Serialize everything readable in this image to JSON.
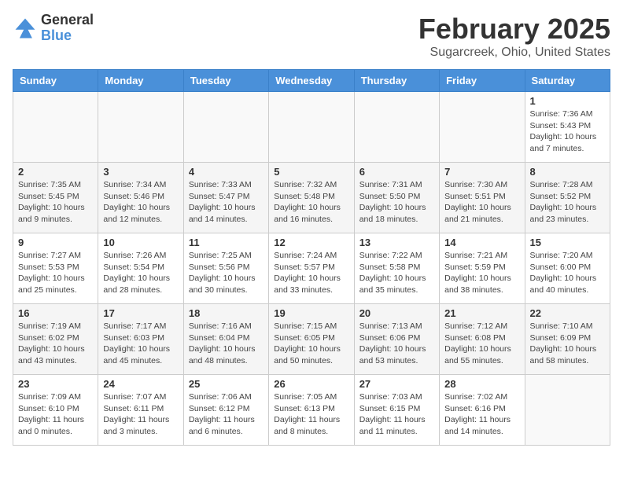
{
  "header": {
    "logo_general": "General",
    "logo_blue": "Blue",
    "month_year": "February 2025",
    "location": "Sugarcreek, Ohio, United States"
  },
  "days_of_week": [
    "Sunday",
    "Monday",
    "Tuesday",
    "Wednesday",
    "Thursday",
    "Friday",
    "Saturday"
  ],
  "weeks": [
    [
      {
        "num": "",
        "info": ""
      },
      {
        "num": "",
        "info": ""
      },
      {
        "num": "",
        "info": ""
      },
      {
        "num": "",
        "info": ""
      },
      {
        "num": "",
        "info": ""
      },
      {
        "num": "",
        "info": ""
      },
      {
        "num": "1",
        "info": "Sunrise: 7:36 AM\nSunset: 5:43 PM\nDaylight: 10 hours\nand 7 minutes."
      }
    ],
    [
      {
        "num": "2",
        "info": "Sunrise: 7:35 AM\nSunset: 5:45 PM\nDaylight: 10 hours\nand 9 minutes."
      },
      {
        "num": "3",
        "info": "Sunrise: 7:34 AM\nSunset: 5:46 PM\nDaylight: 10 hours\nand 12 minutes."
      },
      {
        "num": "4",
        "info": "Sunrise: 7:33 AM\nSunset: 5:47 PM\nDaylight: 10 hours\nand 14 minutes."
      },
      {
        "num": "5",
        "info": "Sunrise: 7:32 AM\nSunset: 5:48 PM\nDaylight: 10 hours\nand 16 minutes."
      },
      {
        "num": "6",
        "info": "Sunrise: 7:31 AM\nSunset: 5:50 PM\nDaylight: 10 hours\nand 18 minutes."
      },
      {
        "num": "7",
        "info": "Sunrise: 7:30 AM\nSunset: 5:51 PM\nDaylight: 10 hours\nand 21 minutes."
      },
      {
        "num": "8",
        "info": "Sunrise: 7:28 AM\nSunset: 5:52 PM\nDaylight: 10 hours\nand 23 minutes."
      }
    ],
    [
      {
        "num": "9",
        "info": "Sunrise: 7:27 AM\nSunset: 5:53 PM\nDaylight: 10 hours\nand 25 minutes."
      },
      {
        "num": "10",
        "info": "Sunrise: 7:26 AM\nSunset: 5:54 PM\nDaylight: 10 hours\nand 28 minutes."
      },
      {
        "num": "11",
        "info": "Sunrise: 7:25 AM\nSunset: 5:56 PM\nDaylight: 10 hours\nand 30 minutes."
      },
      {
        "num": "12",
        "info": "Sunrise: 7:24 AM\nSunset: 5:57 PM\nDaylight: 10 hours\nand 33 minutes."
      },
      {
        "num": "13",
        "info": "Sunrise: 7:22 AM\nSunset: 5:58 PM\nDaylight: 10 hours\nand 35 minutes."
      },
      {
        "num": "14",
        "info": "Sunrise: 7:21 AM\nSunset: 5:59 PM\nDaylight: 10 hours\nand 38 minutes."
      },
      {
        "num": "15",
        "info": "Sunrise: 7:20 AM\nSunset: 6:00 PM\nDaylight: 10 hours\nand 40 minutes."
      }
    ],
    [
      {
        "num": "16",
        "info": "Sunrise: 7:19 AM\nSunset: 6:02 PM\nDaylight: 10 hours\nand 43 minutes."
      },
      {
        "num": "17",
        "info": "Sunrise: 7:17 AM\nSunset: 6:03 PM\nDaylight: 10 hours\nand 45 minutes."
      },
      {
        "num": "18",
        "info": "Sunrise: 7:16 AM\nSunset: 6:04 PM\nDaylight: 10 hours\nand 48 minutes."
      },
      {
        "num": "19",
        "info": "Sunrise: 7:15 AM\nSunset: 6:05 PM\nDaylight: 10 hours\nand 50 minutes."
      },
      {
        "num": "20",
        "info": "Sunrise: 7:13 AM\nSunset: 6:06 PM\nDaylight: 10 hours\nand 53 minutes."
      },
      {
        "num": "21",
        "info": "Sunrise: 7:12 AM\nSunset: 6:08 PM\nDaylight: 10 hours\nand 55 minutes."
      },
      {
        "num": "22",
        "info": "Sunrise: 7:10 AM\nSunset: 6:09 PM\nDaylight: 10 hours\nand 58 minutes."
      }
    ],
    [
      {
        "num": "23",
        "info": "Sunrise: 7:09 AM\nSunset: 6:10 PM\nDaylight: 11 hours\nand 0 minutes."
      },
      {
        "num": "24",
        "info": "Sunrise: 7:07 AM\nSunset: 6:11 PM\nDaylight: 11 hours\nand 3 minutes."
      },
      {
        "num": "25",
        "info": "Sunrise: 7:06 AM\nSunset: 6:12 PM\nDaylight: 11 hours\nand 6 minutes."
      },
      {
        "num": "26",
        "info": "Sunrise: 7:05 AM\nSunset: 6:13 PM\nDaylight: 11 hours\nand 8 minutes."
      },
      {
        "num": "27",
        "info": "Sunrise: 7:03 AM\nSunset: 6:15 PM\nDaylight: 11 hours\nand 11 minutes."
      },
      {
        "num": "28",
        "info": "Sunrise: 7:02 AM\nSunset: 6:16 PM\nDaylight: 11 hours\nand 14 minutes."
      },
      {
        "num": "",
        "info": ""
      }
    ]
  ]
}
